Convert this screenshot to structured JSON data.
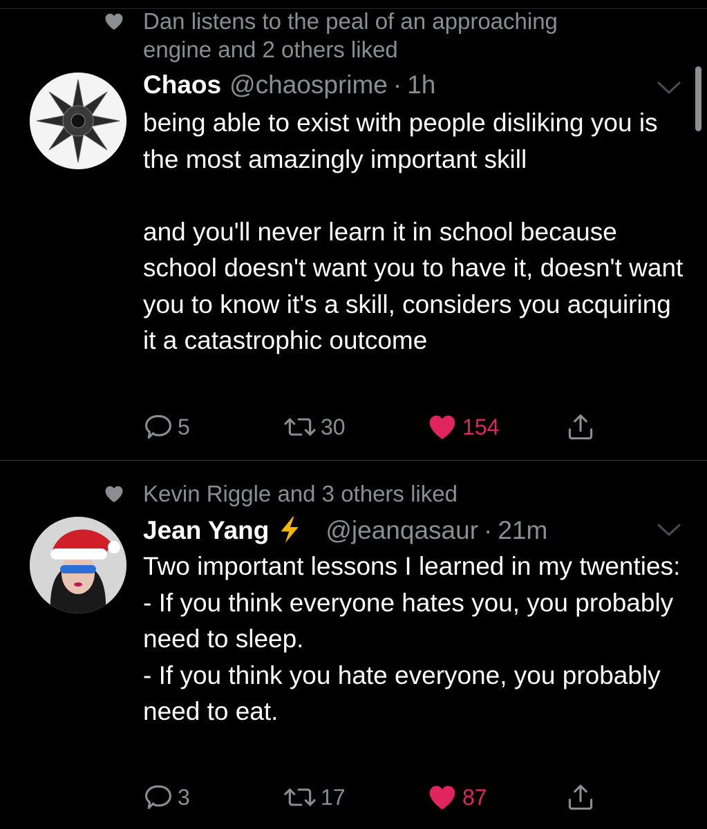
{
  "tweets": [
    {
      "social_context": "Dan listens to the peal of an approaching engine and 2 others liked",
      "name": "Chaos",
      "verified_emoji": "",
      "handle": "@chaosprime",
      "separator": "·",
      "time": "1h",
      "text": "being able to exist with people disliking you is the most amazingly important skill\n\nand you'll never learn it in school because school doesn't want you to have it, doesn't want you to know it's a skill, considers you acquiring it a catastrophic outcome",
      "reply_count": "5",
      "retweet_count": "30",
      "like_count": "154",
      "liked": true,
      "avatar_icon": "chaos-star-avatar"
    },
    {
      "social_context": "Kevin Riggle and 3 others liked",
      "name": "Jean Yang",
      "name_emoji_icon": "lightning-bolt-icon",
      "handle": "@jeanqasaur",
      "separator": "·",
      "time": "21m",
      "text": "Two important lessons I learned in my twenties:\n- If you think everyone hates you, you probably need to sleep.\n- If you think you hate everyone, you probably need to eat.",
      "reply_count": "3",
      "retweet_count": "17",
      "like_count": "87",
      "liked": true,
      "avatar_icon": "santa-hat-person-avatar"
    }
  ],
  "colors": {
    "background": "#000000",
    "secondary_text": "#8a8d91",
    "like_red": "#e0245e",
    "bolt_yellow": "#f5b800"
  },
  "icons": [
    "heart-icon",
    "chevron-down-icon",
    "reply-icon",
    "retweet-icon",
    "share-icon",
    "lightning-bolt-icon"
  ]
}
